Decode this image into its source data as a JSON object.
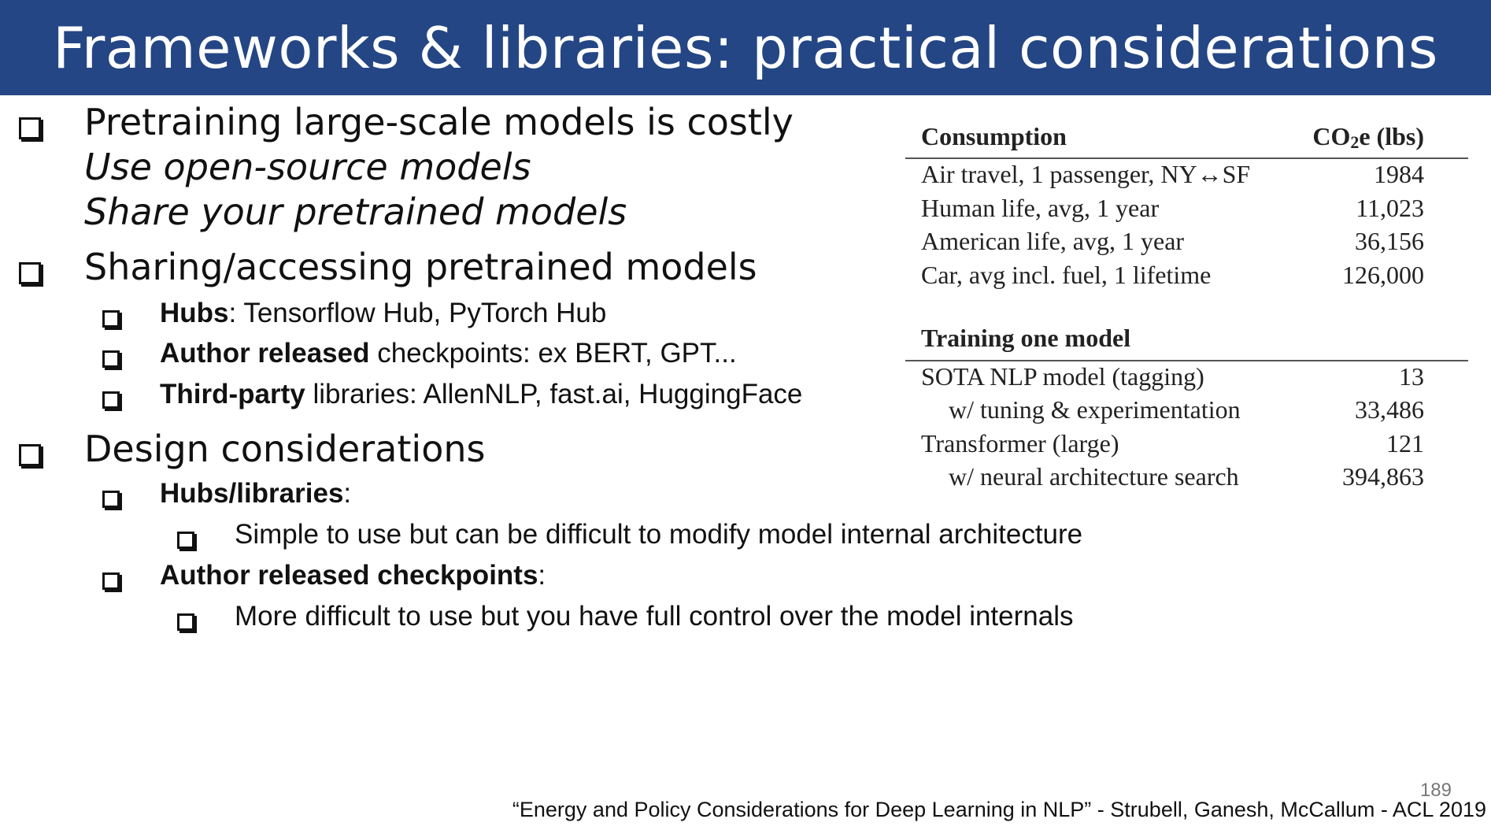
{
  "header": {
    "title": "Frameworks & libraries: practical considerations"
  },
  "bullets": {
    "b1": {
      "text": "Pretraining large-scale models is costly",
      "line2": "Use open-source models",
      "line3": "Share your pretrained models"
    },
    "b2": {
      "text": "Sharing/accessing pretrained models",
      "items": [
        {
          "bold": "Hubs",
          "rest": ": Tensorflow Hub, PyTorch Hub"
        },
        {
          "bold": "Author released",
          "rest": " checkpoints: ex BERT, GPT..."
        },
        {
          "bold": "Third-party",
          "rest": " libraries: AllenNLP, fast.ai, HuggingFace"
        }
      ]
    },
    "b3": {
      "text": "Design considerations",
      "items": [
        {
          "bold": "Hubs/libraries",
          "rest": ":",
          "sub": "Simple to use but can be difficult to modify model internal architecture"
        },
        {
          "bold": "Author released checkpoints",
          "rest": ":",
          "sub": "More difficult to use but you have full control over the model internals"
        }
      ]
    }
  },
  "table": {
    "header": {
      "col1": "Consumption",
      "col2_prefix": "CO",
      "col2_sub": "2",
      "col2_suffix": "e (lbs)"
    },
    "rows1": [
      {
        "label": "Air travel, 1 passenger, NY↔SF",
        "value": "1984"
      },
      {
        "label": "Human life, avg, 1 year",
        "value": "11,023"
      },
      {
        "label": "American life, avg, 1 year",
        "value": "36,156"
      },
      {
        "label": "Car, avg incl. fuel, 1 lifetime",
        "value": "126,000"
      }
    ],
    "section2": "Training one model",
    "rows2": [
      {
        "label": "SOTA NLP model (tagging)",
        "value": "13"
      },
      {
        "label": "w/ tuning & experimentation",
        "value": "33,486"
      },
      {
        "label": "Transformer (large)",
        "value": "121"
      },
      {
        "label": "w/ neural architecture search",
        "value": "394,863"
      }
    ]
  },
  "footer": {
    "page_number": "189",
    "citation": "“Energy and Policy Considerations for Deep Learning in NLP” - Strubell, Ganesh, McCallum - ACL 2019"
  }
}
